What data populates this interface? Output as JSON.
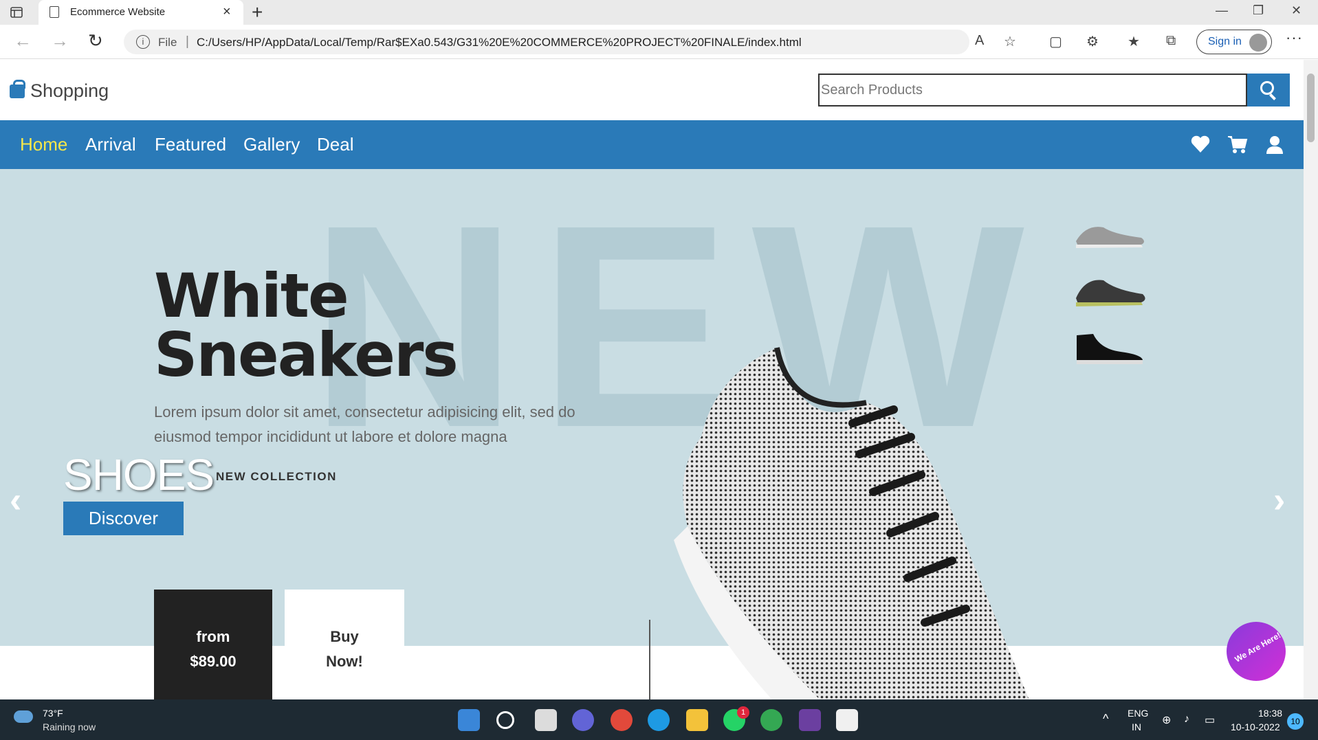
{
  "browser": {
    "tab_title": "Ecommerce Website",
    "address": {
      "scheme_label": "File",
      "url": "C:/Users/HP/AppData/Local/Temp/Rar$EXa0.543/G31%20E%20COMMERCE%20PROJECT%20FINALE/index.html"
    },
    "signin_label": "Sign in"
  },
  "site": {
    "logo_text": "Shopping",
    "search": {
      "placeholder": "Search Products"
    },
    "nav": [
      {
        "label": "Home",
        "active": true
      },
      {
        "label": "Arrival"
      },
      {
        "label": "Featured"
      },
      {
        "label": "Gallery"
      },
      {
        "label": "Deal"
      }
    ],
    "nav_icons": [
      "heart-icon",
      "cart-icon",
      "user-icon"
    ],
    "accent_color": "#2a7ab8",
    "active_nav_color": "#f5e84a"
  },
  "hero": {
    "background_word": "NEW",
    "title_line1": "White",
    "title_line2": "Sneakers",
    "description_line1": "Lorem ipsum dolor sit amet, consectetur adipisicing elit, sed do",
    "description_line2": "eiusmod tempor incididunt ut labore et dolore magna",
    "shoes_title": "SHOES",
    "collection_label": "NEW COLLECTION",
    "cta_label": "Discover",
    "price_from": "from",
    "price": "$89.00",
    "buy_line1": "Buy",
    "buy_line2": "Now!",
    "background_color": "#c9dde3"
  },
  "chat_widget": {
    "label": "We Are Here!"
  },
  "taskbar": {
    "weather": {
      "temp": "73°F",
      "desc": "Raining now"
    },
    "whatsapp_badge": "1",
    "language": {
      "line1": "ENG",
      "line2": "IN"
    },
    "clock": {
      "time": "18:38",
      "date": "10-10-2022"
    },
    "notification_count": "10"
  }
}
